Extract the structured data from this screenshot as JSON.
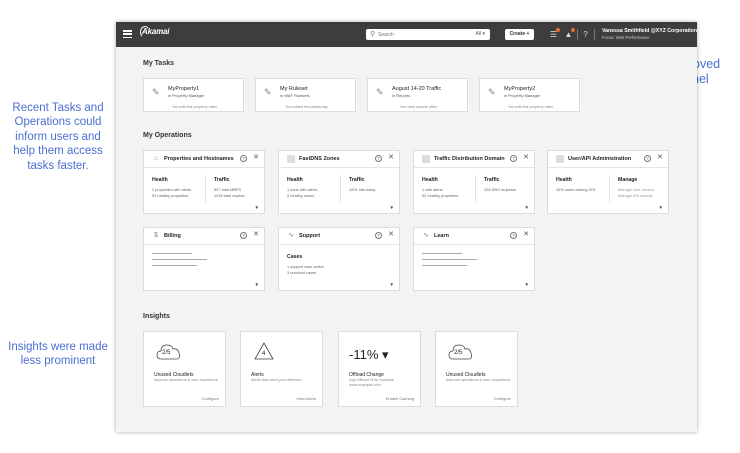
{
  "annotations": {
    "recent_tasks": "Recent Tasks and Operations could inform users and help them access tasks faster.",
    "insights": "Insights were made less prominent",
    "activity_feed": "Activity Feed was moved into an overlay panel"
  },
  "header": {
    "logo": "Akamai",
    "search_placeholder": "Search",
    "search_filter": "All",
    "create_label": "Create +",
    "user_name": "Vanessa Smithfield @XYZ Corporation",
    "user_context": "Focus: Web Performance"
  },
  "tasks": {
    "title": "My Tasks",
    "items": [
      {
        "title": "MyProperty1",
        "sub": "in Property Manager",
        "meta": "You edit this property often"
      },
      {
        "title": "My Ruleset",
        "sub": "in WAF Rulesets",
        "meta": "You edited this yesterday"
      },
      {
        "title": "August 14-20 Traffic",
        "sub": "in Reports",
        "meta": "You view reports often"
      },
      {
        "title": "MyProperty2",
        "sub": "in Property Manager",
        "meta": "You edit this property often"
      }
    ]
  },
  "operations": {
    "title": "My Operations",
    "cards": [
      {
        "title": "Properties and Hostnames",
        "left_label": "Health",
        "left_lines": [
          "2 properties with alerts",
          "52 healthy properties"
        ],
        "right_label": "Traffic",
        "right_lines": [
          "827 total MBPS",
          "1018 total req/sec"
        ]
      },
      {
        "title": "FastDNS Zones",
        "left_label": "Health",
        "left_lines": [
          "1 zone with alerts",
          "5 healthy zones"
        ],
        "right_label": "Traffic",
        "right_lines": [
          "1201 hits today"
        ]
      },
      {
        "title": "Traffic Distribution Domain",
        "left_label": "Health",
        "left_lines": [
          "1 with alerts",
          "52 healthy properties"
        ],
        "right_label": "Traffic",
        "right_lines": [
          "128 DNS requests"
        ]
      },
      {
        "title": "User/API Administration",
        "left_label": "Health",
        "left_lines": [
          "10% users lacking 2FA"
        ],
        "right_label": "Manage",
        "right_lines": [
          "Manage user access",
          "Manage API access"
        ]
      },
      {
        "title": "Billing"
      },
      {
        "title": "Support",
        "left_label": "Cases",
        "left_lines": [
          "1 support case active",
          "3 resolved cases"
        ]
      },
      {
        "title": "Learn"
      }
    ]
  },
  "insights": {
    "title": "Insights",
    "cards": [
      {
        "badge": "2/5",
        "title": "Unused Cloudlets",
        "desc": "Improve operations & user experience",
        "action": "Configure"
      },
      {
        "badge": "4",
        "title": "Alerts",
        "desc": "Alerts that need your attention",
        "action": "View Alerts"
      },
      {
        "big": "-11% ▾",
        "title": "Offload Change",
        "desc": "Avg Offload % for example www.example.com",
        "action": "Enable Caching"
      },
      {
        "badge": "2/5",
        "title": "Unused Cloudlets",
        "desc": "Improve operations & user experience",
        "action": "Configure"
      }
    ]
  },
  "colors": {
    "annotation": "#4a6fd3",
    "topbar": "#3d3d3d",
    "alert": "#e8702a"
  }
}
